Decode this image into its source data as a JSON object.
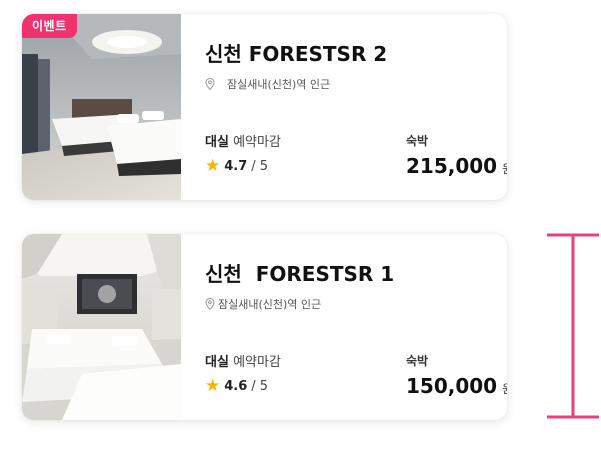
{
  "listings": [
    {
      "badge": "이벤트",
      "name": "신천 FORESTSR 2",
      "location": "잠실새내(신천)역 인근",
      "room_type": "대실",
      "booking_state": "예약마감",
      "rating": "4.7",
      "rating_max": "/ 5",
      "stay_label": "숙박",
      "price": "215,000",
      "currency": "원"
    },
    {
      "name": "신천  FORESTSR 1",
      "location": "잠실새내(신천)역 인근",
      "room_type": "대실",
      "booking_state": "예약마감",
      "rating": "4.6",
      "rating_max": "/ 5",
      "stay_label": "숙박",
      "price": "150,000",
      "currency": "원"
    }
  ],
  "icons": {
    "pin": "location-pin-icon",
    "star": "star-icon"
  },
  "colors": {
    "badge": "#f0326f",
    "star": "#f7b500",
    "annotation": "#e8407f"
  }
}
